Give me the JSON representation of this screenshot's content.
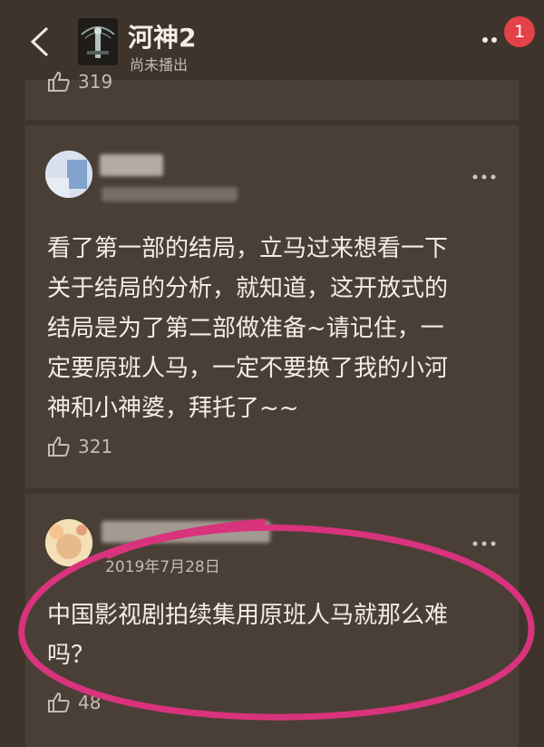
{
  "header": {
    "title": "河神2",
    "subtitle": "尚未播出",
    "notification_count": "1"
  },
  "comments": [
    {
      "likes": "319"
    },
    {
      "text": "看了第一部的结局，立马过来想看一下\n关于结局的分析，就知道，这开放式的\n结局是为了第二部做准备~请记住，一\n定要原班人马，一定不要换了我的小河\n神和小神婆，拜托了~~",
      "likes": "321"
    },
    {
      "date": "2019年7月28日",
      "text": "中国影视剧拍续集用原班人马就那么难\n吗？",
      "likes": "48"
    }
  ],
  "icons": {
    "back": "chevron-left-icon",
    "more": "more-dots-icon",
    "like": "thumbs-up-icon"
  },
  "colors": {
    "background": "#3e342c",
    "card": "#4a3f36",
    "badge": "#e4414b",
    "annotation": "#d8337c"
  }
}
